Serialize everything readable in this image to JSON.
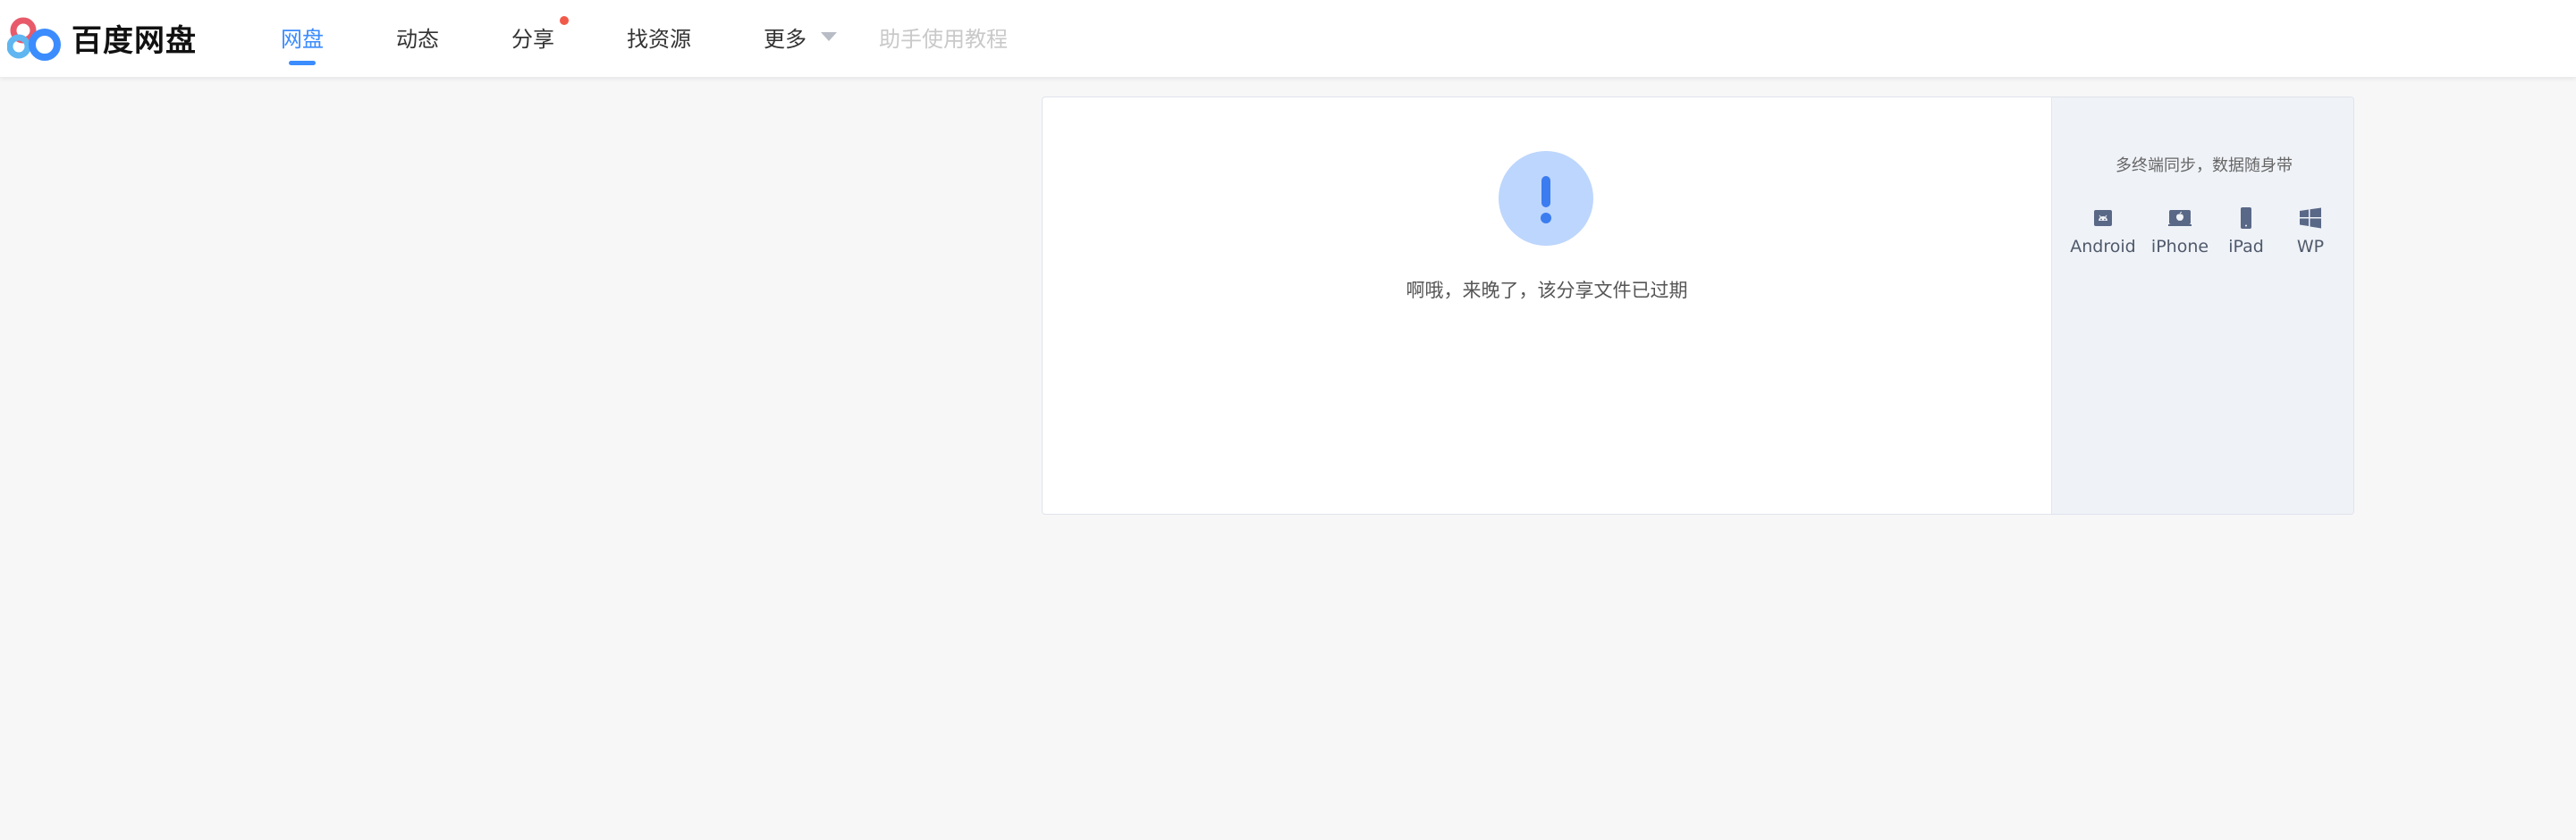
{
  "header": {
    "logo_text": "百度网盘",
    "nav": [
      {
        "label": "网盘",
        "active": true
      },
      {
        "label": "动态"
      },
      {
        "label": "分享",
        "badge_dot": true
      },
      {
        "label": "找资源"
      },
      {
        "label": "更多",
        "has_dropdown": true
      },
      {
        "label": "助手使用教程",
        "muted": true
      }
    ]
  },
  "main": {
    "alert_icon": "exclamation-icon",
    "message": "啊哦，来晚了，该分享文件已过期"
  },
  "sidebar": {
    "title": "多终端同步，数据随身带",
    "platforms": [
      {
        "label": "Android",
        "icon": "android-icon"
      },
      {
        "label": "iPhone",
        "icon": "apple-icon"
      },
      {
        "label": "iPad",
        "icon": "tablet-icon"
      },
      {
        "label": "WP",
        "icon": "windows-icon"
      }
    ]
  },
  "colors": {
    "accent": "#3b8cff",
    "badge": "#f15a4a",
    "alert_bg": "#bdd6fd",
    "alert_fg": "#3b7cf0",
    "platform_icon": "#5a6887"
  }
}
